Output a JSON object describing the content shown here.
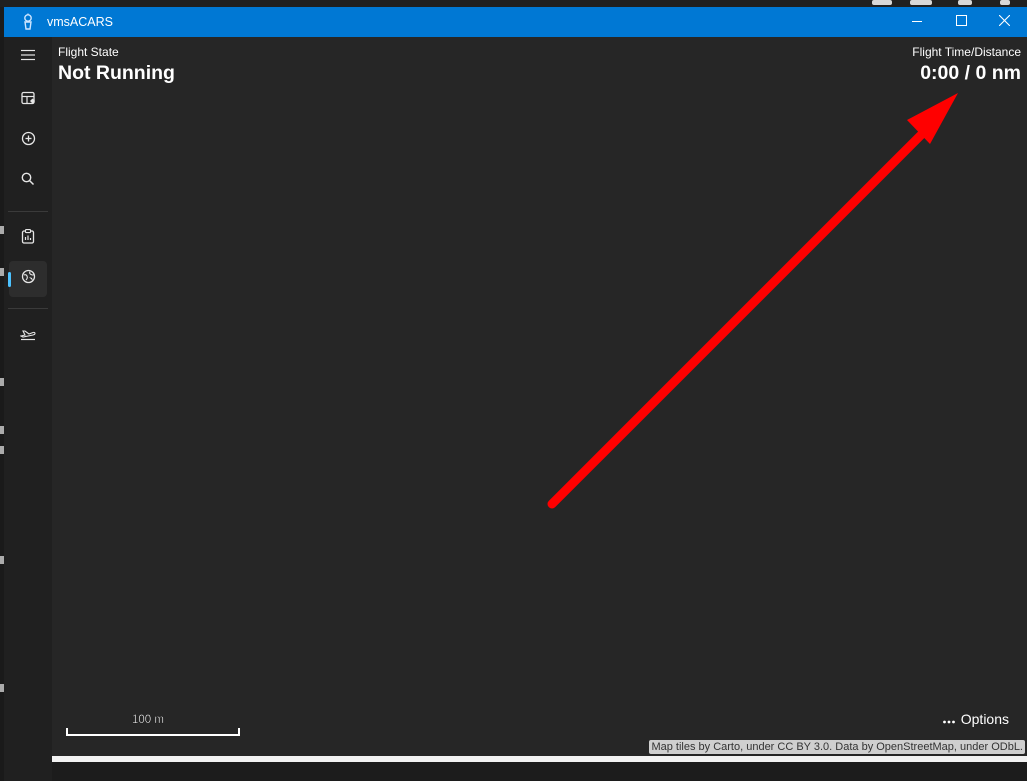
{
  "window": {
    "title": "vmsACARS",
    "accent": "#0078d4",
    "controls": [
      "minimize-icon",
      "maximize-icon",
      "close-icon"
    ]
  },
  "sidebar": {
    "items": [
      {
        "name": "menu",
        "icon": "hamburger-icon"
      },
      {
        "name": "bids",
        "icon": "bids-icon"
      },
      {
        "name": "new-flight",
        "icon": "add-circle-icon"
      },
      {
        "name": "search",
        "icon": "search-icon"
      },
      {
        "name": "reports",
        "icon": "clipboard-icon"
      },
      {
        "name": "live-flight",
        "icon": "map-globe-icon",
        "active": true
      },
      {
        "name": "aircraft",
        "icon": "plane-takeoff-icon"
      }
    ]
  },
  "header": {
    "flight_state_label": "Flight State",
    "flight_state_value": "Not Running",
    "flight_time_distance_label": "Flight Time/Distance",
    "flight_time_distance_value": "0:00 / 0 nm"
  },
  "map": {
    "scale_label": "100 m",
    "options_label": "Options",
    "options_icon": "ellipsis-icon",
    "attribution": "Map tiles by Carto, under CC BY 3.0. Data by OpenStreetMap, under ODbL.",
    "annotation_arrow_color": "#ff0000"
  },
  "progress": {
    "value": 1.0
  }
}
